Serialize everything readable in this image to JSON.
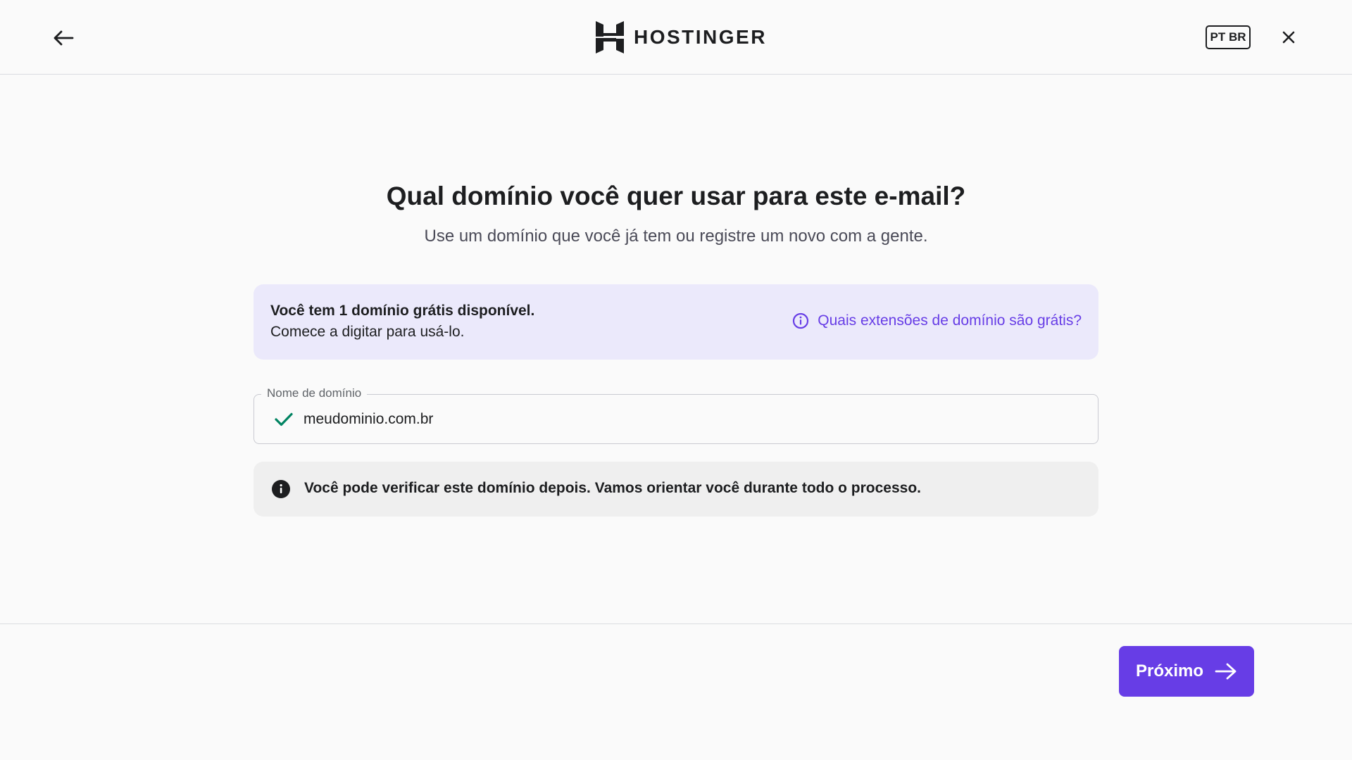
{
  "header": {
    "brand": "HOSTINGER",
    "language": "PT BR"
  },
  "main": {
    "title": "Qual domínio você quer usar para este e-mail?",
    "subtitle": "Use um domínio que você já tem ou registre um novo com a gente.",
    "promo": {
      "line1": "Você tem 1 domínio grátis disponível.",
      "line2": "Comece a digitar para usá-lo.",
      "link": "Quais extensões de domínio são grátis?"
    },
    "domain_field": {
      "label": "Nome de domínio",
      "value": "meudominio.com.br"
    },
    "notice": "Você pode verificar este domínio depois. Vamos orientar você durante todo o processo."
  },
  "footer": {
    "next_label": "Próximo"
  },
  "colors": {
    "accent": "#673de6",
    "promo_bg": "#ebe9fb",
    "success": "#00b090"
  },
  "icons": [
    "arrow-left-icon",
    "hostinger-logo",
    "close-icon",
    "info-outline-icon",
    "check-icon",
    "info-filled-icon",
    "arrow-right-icon"
  ]
}
